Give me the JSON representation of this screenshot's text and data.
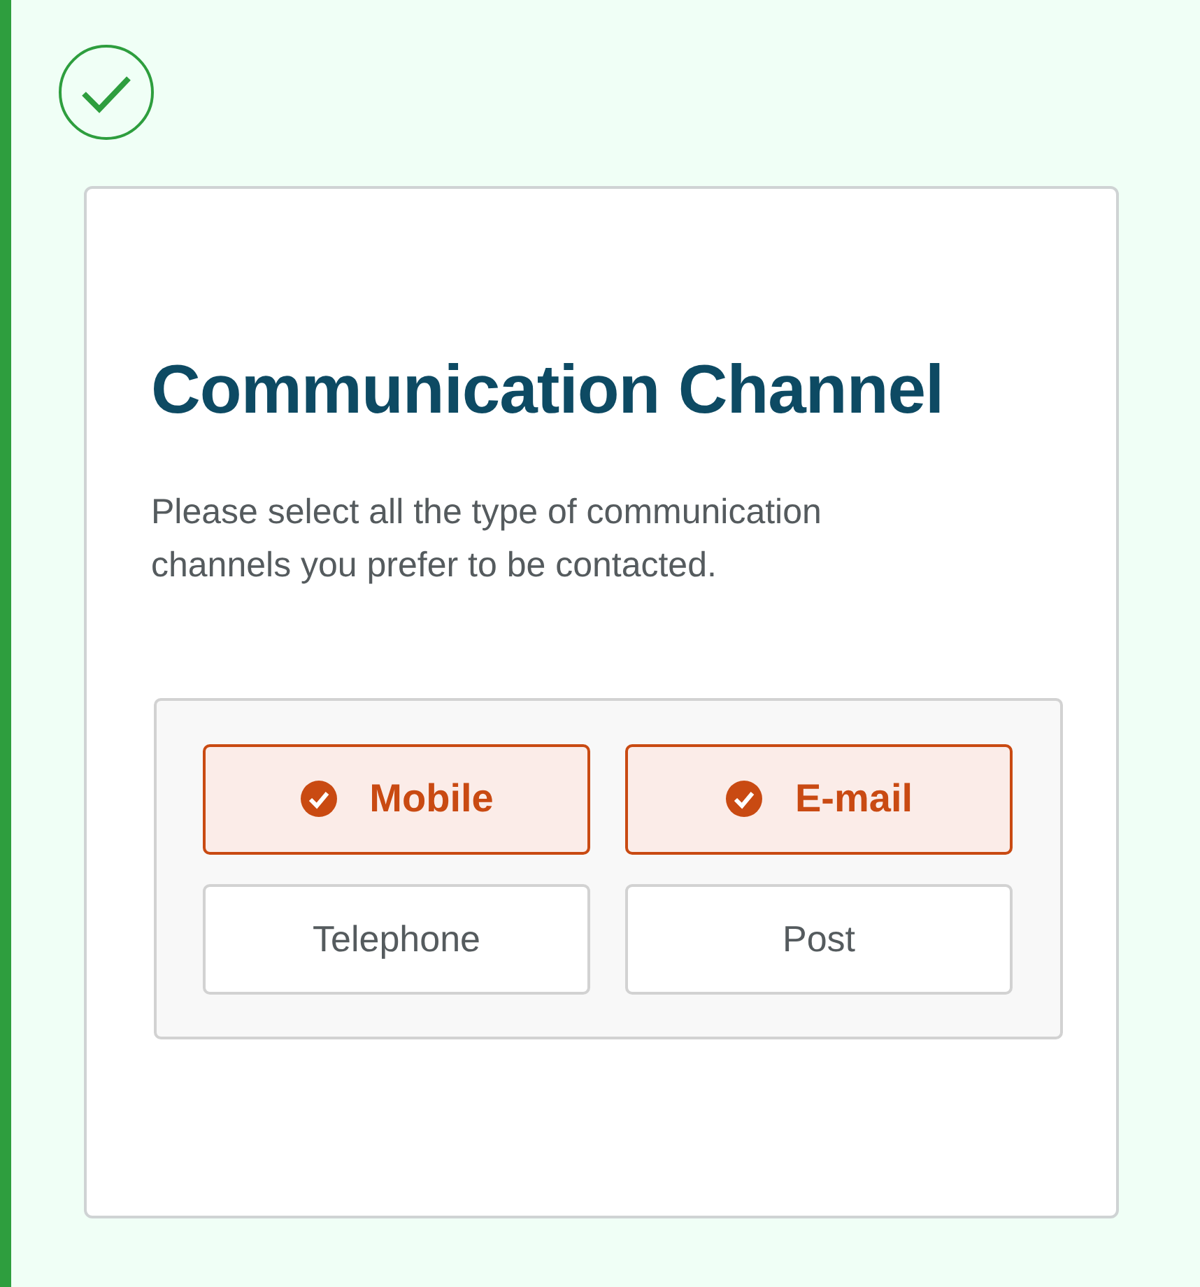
{
  "status": {
    "complete": true
  },
  "card": {
    "title": "Communication Channel",
    "description": "Please select all the type of communication channels you prefer to be contacted.",
    "options": [
      {
        "label": "Mobile",
        "selected": true
      },
      {
        "label": "E-mail",
        "selected": true
      },
      {
        "label": "Telephone",
        "selected": false
      },
      {
        "label": "Post",
        "selected": false
      }
    ]
  }
}
